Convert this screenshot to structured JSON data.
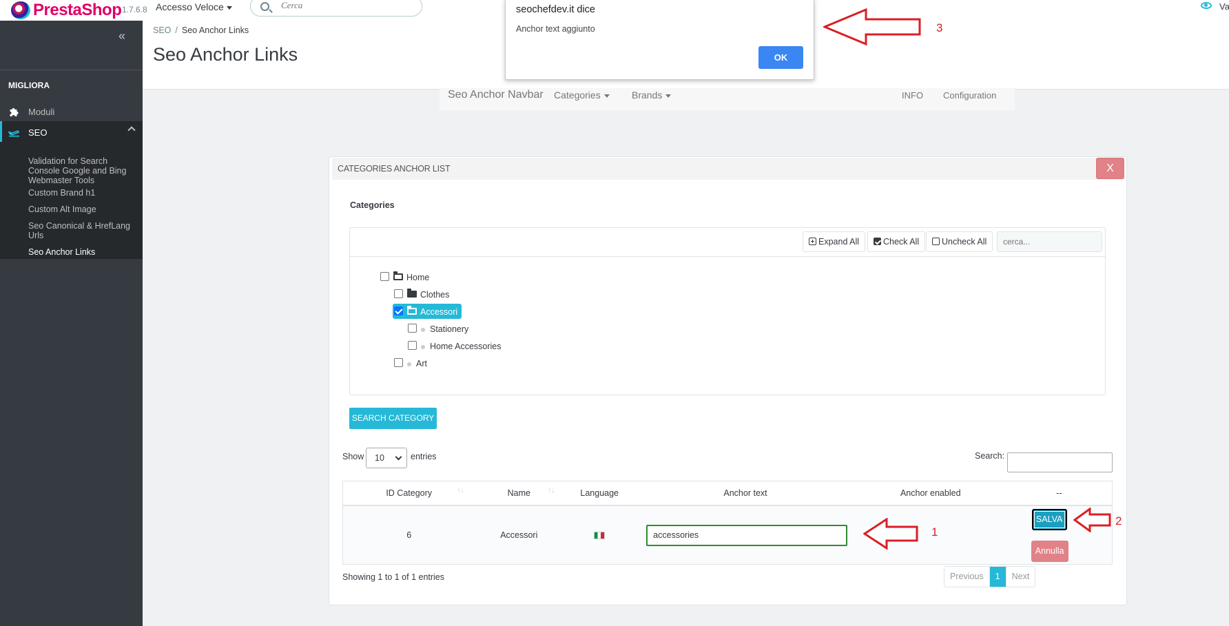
{
  "header": {
    "logo_text_1": "Presta",
    "logo_text_2": "Shop",
    "version": "1.7.6.8",
    "quick_access": "Accesso Veloce",
    "search_placeholder": "Cerca",
    "view_label": "Va"
  },
  "sidebar": {
    "section": "MIGLIORA",
    "items": [
      {
        "label": "Moduli"
      },
      {
        "label": "SEO"
      }
    ],
    "submenu": [
      {
        "label": "Validation for Search Console Google and Bing Webmaster Tools"
      },
      {
        "label": "Custom Brand h1"
      },
      {
        "label": "Custom Alt Image"
      },
      {
        "label": "Seo Canonical & HrefLang Urls"
      },
      {
        "label": "Seo Anchor Links"
      }
    ]
  },
  "breadcrumb": {
    "parent": "SEO",
    "separator": "/",
    "current": "Seo Anchor Links"
  },
  "page_title": "Seo Anchor Links",
  "module_nav": {
    "brand": "Seo Anchor Navbar",
    "categories": "Categories",
    "brands": "Brands",
    "info": "INFO",
    "configuration": "Configuration"
  },
  "panel": {
    "title": "CATEGORIES ANCHOR LIST",
    "close": "X",
    "categories_label": "Categories",
    "tree_toolbar": {
      "expand_all": "Expand All",
      "check_all": "Check All",
      "uncheck_all": "Uncheck All",
      "search_placeholder": "cerca..."
    },
    "tree": [
      {
        "label": "Home"
      },
      {
        "label": "Clothes"
      },
      {
        "label": "Accessori"
      },
      {
        "label": "Stationery"
      },
      {
        "label": "Home Accessories"
      },
      {
        "label": "Art"
      }
    ],
    "search_category_button": "SEARCH CATEGORY",
    "table": {
      "show_label": "Show",
      "page_size": "10",
      "entries_label": "entries",
      "search_label": "Search:",
      "columns": [
        "ID Category",
        "Name",
        "Language",
        "Anchor text",
        "Anchor enabled",
        "--"
      ],
      "rows": [
        {
          "id": "6",
          "name": "Accessori",
          "language": "it",
          "anchor_text": "accessories",
          "anchor_enabled": ""
        }
      ],
      "save_button": "SALVA",
      "cancel_button": "Annulla",
      "info": "Showing 1 to 1 of 1 entries",
      "pagination": {
        "previous": "Previous",
        "current": "1",
        "next": "Next"
      }
    }
  },
  "dialog": {
    "title": "seochefdev.it dice",
    "message": "Anchor text aggiunto",
    "ok": "OK"
  },
  "annotations": {
    "n1": "1",
    "n2": "2",
    "n3": "3",
    "color": "#d91f25"
  }
}
